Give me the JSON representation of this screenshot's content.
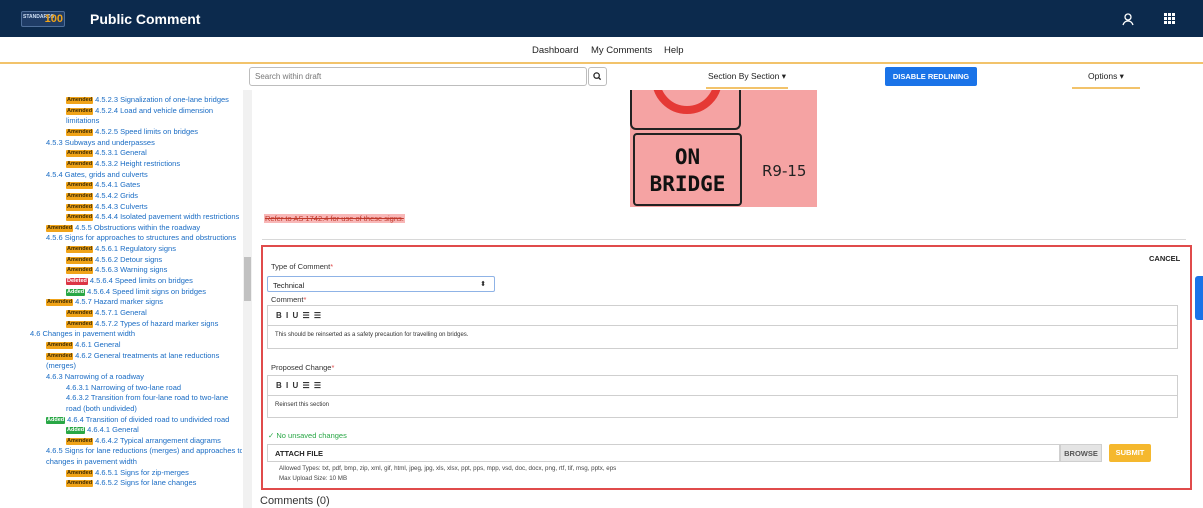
{
  "header": {
    "logo_text": "STANDARDS",
    "logo_number": "100",
    "title": "Public Comment"
  },
  "nav": {
    "items": [
      "Dashboard",
      "My Comments",
      "Help"
    ]
  },
  "toolbar": {
    "search_placeholder": "Search within draft",
    "section_dropdown": "Section By Section ▾",
    "redline_button": "DISABLE REDLINING",
    "options_dropdown": "Options ▾"
  },
  "sidebar": {
    "items": [
      {
        "badge": "Amended",
        "text": "4.5.2.3 Signalization of one-lane bridges"
      },
      {
        "badge": "Amended",
        "text": "4.5.2.4 Load and vehicle dimension"
      },
      {
        "badge": "",
        "text": "limitations"
      },
      {
        "badge": "Amended",
        "text": "4.5.2.5 Speed limits on bridges"
      },
      {
        "badge": "",
        "text": "4.5.3 Subways and underpasses"
      },
      {
        "badge": "Amended",
        "text": "4.5.3.1 General"
      },
      {
        "badge": "Amended",
        "text": "4.5.3.2 Height restrictions"
      },
      {
        "badge": "",
        "text": "4.5.4 Gates, grids and culverts"
      },
      {
        "badge": "Amended",
        "text": "4.5.4.1 Gates"
      },
      {
        "badge": "Amended",
        "text": "4.5.4.2 Grids"
      },
      {
        "badge": "Amended",
        "text": "4.5.4.3 Culverts"
      },
      {
        "badge": "Amended",
        "text": "4.5.4.4 Isolated pavement width restrictions"
      },
      {
        "badge": "Amended",
        "text": "4.5.5 Obstructions within the roadway"
      },
      {
        "badge": "",
        "text": "4.5.6 Signs for approaches to structures and obstructions"
      },
      {
        "badge": "Amended",
        "text": "4.5.6.1 Regulatory signs"
      },
      {
        "badge": "Amended",
        "text": "4.5.6.2 Detour signs"
      },
      {
        "badge": "Amended",
        "text": "4.5.6.3 Warning signs"
      },
      {
        "badge": "Deleted",
        "text": "4.5.6.4 Speed limits on bridges"
      },
      {
        "badge": "Added",
        "text": "4.5.6.4 Speed limit signs on bridges"
      },
      {
        "badge": "Amended",
        "text": "4.5.7 Hazard marker signs"
      },
      {
        "badge": "Amended",
        "text": "4.5.7.1 General"
      },
      {
        "badge": "Amended",
        "text": "4.5.7.2 Types of hazard marker signs"
      },
      {
        "badge": "",
        "text": "4.6 Changes in pavement width"
      },
      {
        "badge": "Amended",
        "text": "4.6.1 General"
      },
      {
        "badge": "Amended",
        "text": "4.6.2 General treatments at lane reductions"
      },
      {
        "badge": "",
        "text": "(merges)"
      },
      {
        "badge": "",
        "text": "4.6.3 Narrowing of a roadway"
      },
      {
        "badge": "",
        "text": "4.6.3.1 Narrowing of two-lane road"
      },
      {
        "badge": "",
        "text": "4.6.3.2 Transition from four-lane road to two-lane"
      },
      {
        "badge": "",
        "text": "road (both undivided)"
      },
      {
        "badge": "Added",
        "text": "4.6.4 Transition of divided road to undivided road"
      },
      {
        "badge": "Added",
        "text": "4.6.4.1 General"
      },
      {
        "badge": "Amended",
        "text": "4.6.4.2 Typical arrangement diagrams"
      },
      {
        "badge": "",
        "text": "4.6.5 Signs for lane reductions (merges) and approaches to"
      },
      {
        "badge": "",
        "text": "changes in pavement width"
      },
      {
        "badge": "Amended",
        "text": "4.6.5.1 Signs for zip-merges"
      },
      {
        "badge": "Amended",
        "text": "4.6.5.2 Signs for lane changes"
      }
    ]
  },
  "content": {
    "sign_line1": "ON",
    "sign_line2": "BRIDGE",
    "sign_code": "R9-15",
    "struck_text": "Refer to AS 1742.4 for use of these signs."
  },
  "form": {
    "cancel": "CANCEL",
    "type_label": "Type of Comment",
    "type_value": "Technical",
    "comment_label": "Comment",
    "comment_text": "This should be reinserted as a safety precaution for travelling on bridges.",
    "proposed_label": "Proposed Change",
    "proposed_text": "Reinsert this section",
    "editor_toolbar": "B I U ☰ ☰",
    "status": "✓ No unsaved changes",
    "attach_label": "ATTACH FILE",
    "browse": "BROWSE",
    "submit": "SUBMIT",
    "allowed_types": "Allowed Types: txt, pdf, bmp, zip, xml, gif, html, jpeg, jpg, xls, xlsx, ppt, pps, mpp, vsd, doc, docx, png, rtf, tif, msg, pptx, eps",
    "max_upload": "Max Upload Size: 10 MB"
  },
  "comments_heading": "Comments (0)",
  "colors": {
    "header_bg": "#0c2a4d",
    "accent": "#f2c36b",
    "link": "#1a6cc4",
    "amended": "#f0a318",
    "added": "#28a745",
    "deleted": "#dc3545",
    "form_border": "#e04b4b",
    "primary_button": "#1a73e8",
    "submit": "#f5b82e"
  }
}
